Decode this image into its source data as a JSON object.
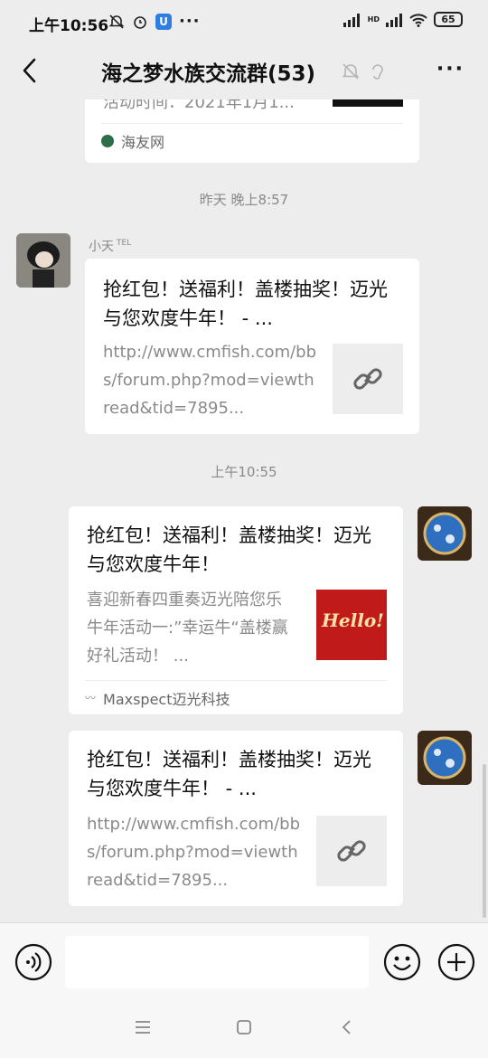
{
  "status_bar": {
    "time": "上午10:56",
    "network_label": "HD",
    "battery": "65"
  },
  "header": {
    "title": "海之梦水族交流群(53)"
  },
  "messages": [
    {
      "partial_desc": "活动时间：2021年1月1...",
      "source": "海友网"
    },
    {
      "timestamp": "昨天 晚上8:57",
      "sender": "小天",
      "sender_tag": "TEL",
      "title": "抢红包！送福利！盖楼抽奖！迈光与您欢度牛年！ - ...",
      "desc": "http://www.cmfish.com/bbs/forum.php?mod=viewthread&tid=7895..."
    },
    {
      "timestamp": "上午10:55",
      "title": "抢红包！送福利！盖楼抽奖！迈光与您欢度牛年！",
      "desc": "喜迎新春四重奏迈光陪您乐牛年活动一:”幸运牛“盖楼赢好礼活动！ ...",
      "thumb_text": "Hello!",
      "source": "Maxspect迈光科技"
    },
    {
      "title": "抢红包！送福利！盖楼抽奖！迈光与您欢度牛年！ - ...",
      "desc": "http://www.cmfish.com/bbs/forum.php?mod=viewthread&tid=7895..."
    }
  ],
  "colors": {
    "background": "#ededed",
    "bubble": "#ffffff",
    "secondary_text": "#8a8a8a"
  },
  "icons": [
    "mute-icon",
    "ear-icon",
    "back-icon",
    "more-icon",
    "link-icon",
    "voice-icon",
    "emoji-icon",
    "plus-icon",
    "menu-icon",
    "home-icon",
    "back-nav-icon"
  ]
}
